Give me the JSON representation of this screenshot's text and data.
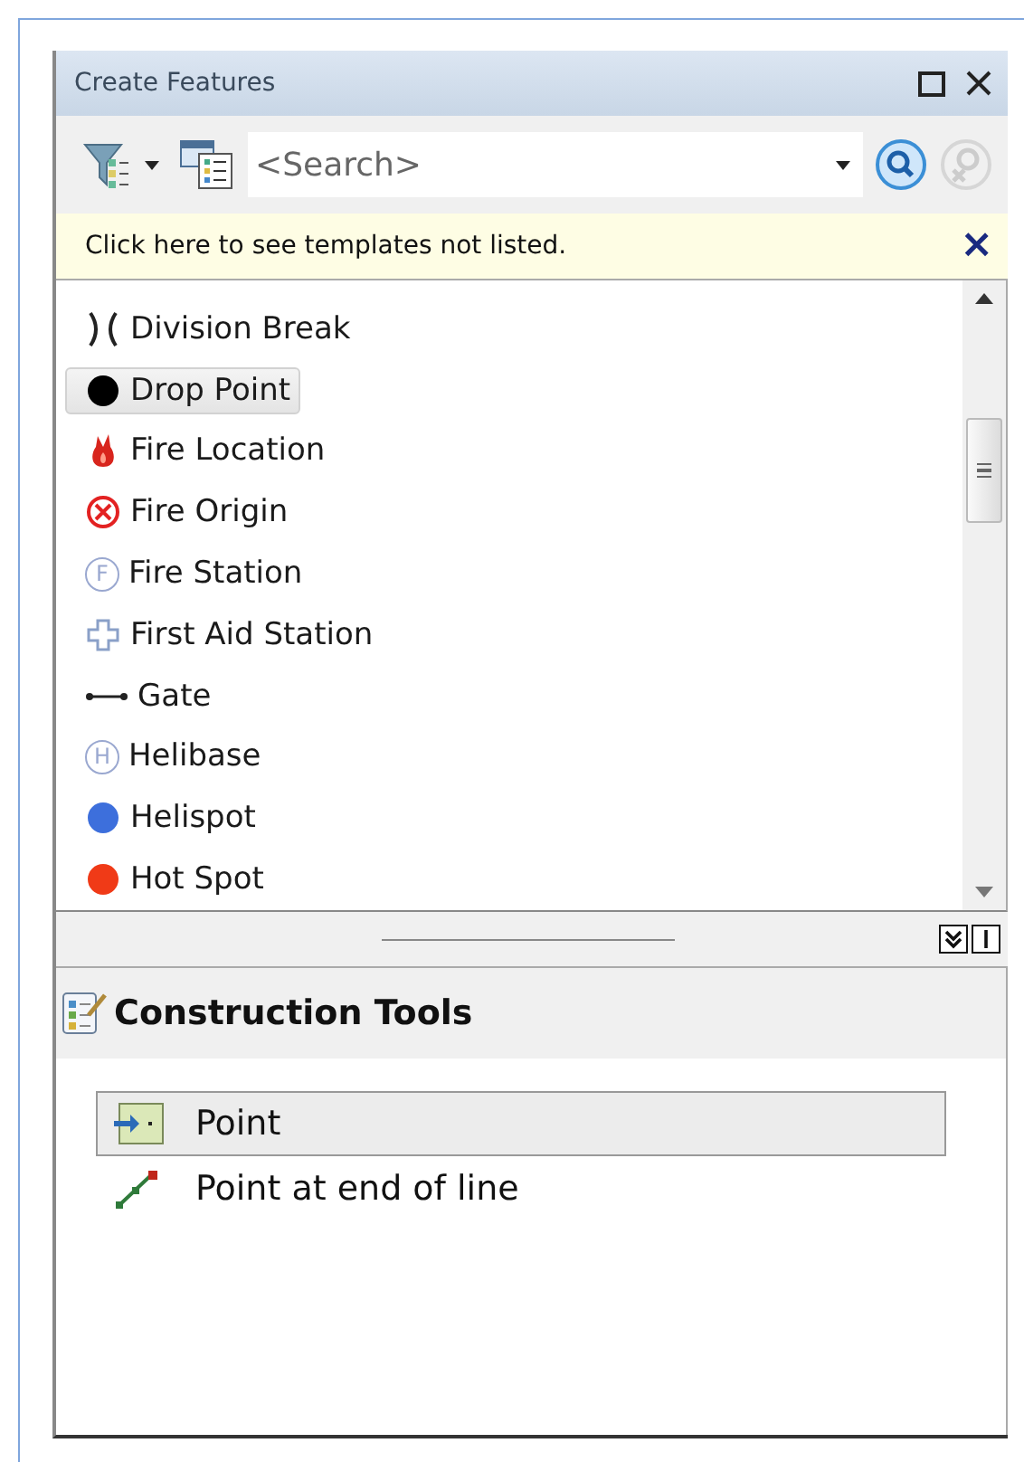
{
  "window": {
    "title": "Create Features"
  },
  "search": {
    "placeholder": "<Search>"
  },
  "notice": {
    "text": "Click here to see templates not listed.",
    "close": "×"
  },
  "templates": [
    {
      "label": "Division Break",
      "kind": "break",
      "selected": false
    },
    {
      "label": "Drop Point",
      "kind": "dot",
      "color": "#000000",
      "selected": true
    },
    {
      "label": "Fire Location",
      "kind": "fire",
      "selected": false
    },
    {
      "label": "Fire Origin",
      "kind": "circle-x",
      "selected": false
    },
    {
      "label": "Fire Station",
      "kind": "letter-circle",
      "letter": "F",
      "selected": false
    },
    {
      "label": "First Aid Station",
      "kind": "cross",
      "selected": false
    },
    {
      "label": "Gate",
      "kind": "gate",
      "selected": false
    },
    {
      "label": "Helibase",
      "kind": "letter-circle",
      "letter": "H",
      "selected": false
    },
    {
      "label": "Helispot",
      "kind": "dot",
      "color": "#3d6fdc",
      "selected": false
    },
    {
      "label": "Hot Spot",
      "kind": "dot",
      "color": "#f03a17",
      "selected": false
    }
  ],
  "construction_tools": {
    "title": "Construction Tools",
    "items": [
      {
        "label": "Point",
        "kind": "point",
        "selected": true
      },
      {
        "label": "Point at end of line",
        "kind": "line-end",
        "selected": false
      }
    ]
  }
}
